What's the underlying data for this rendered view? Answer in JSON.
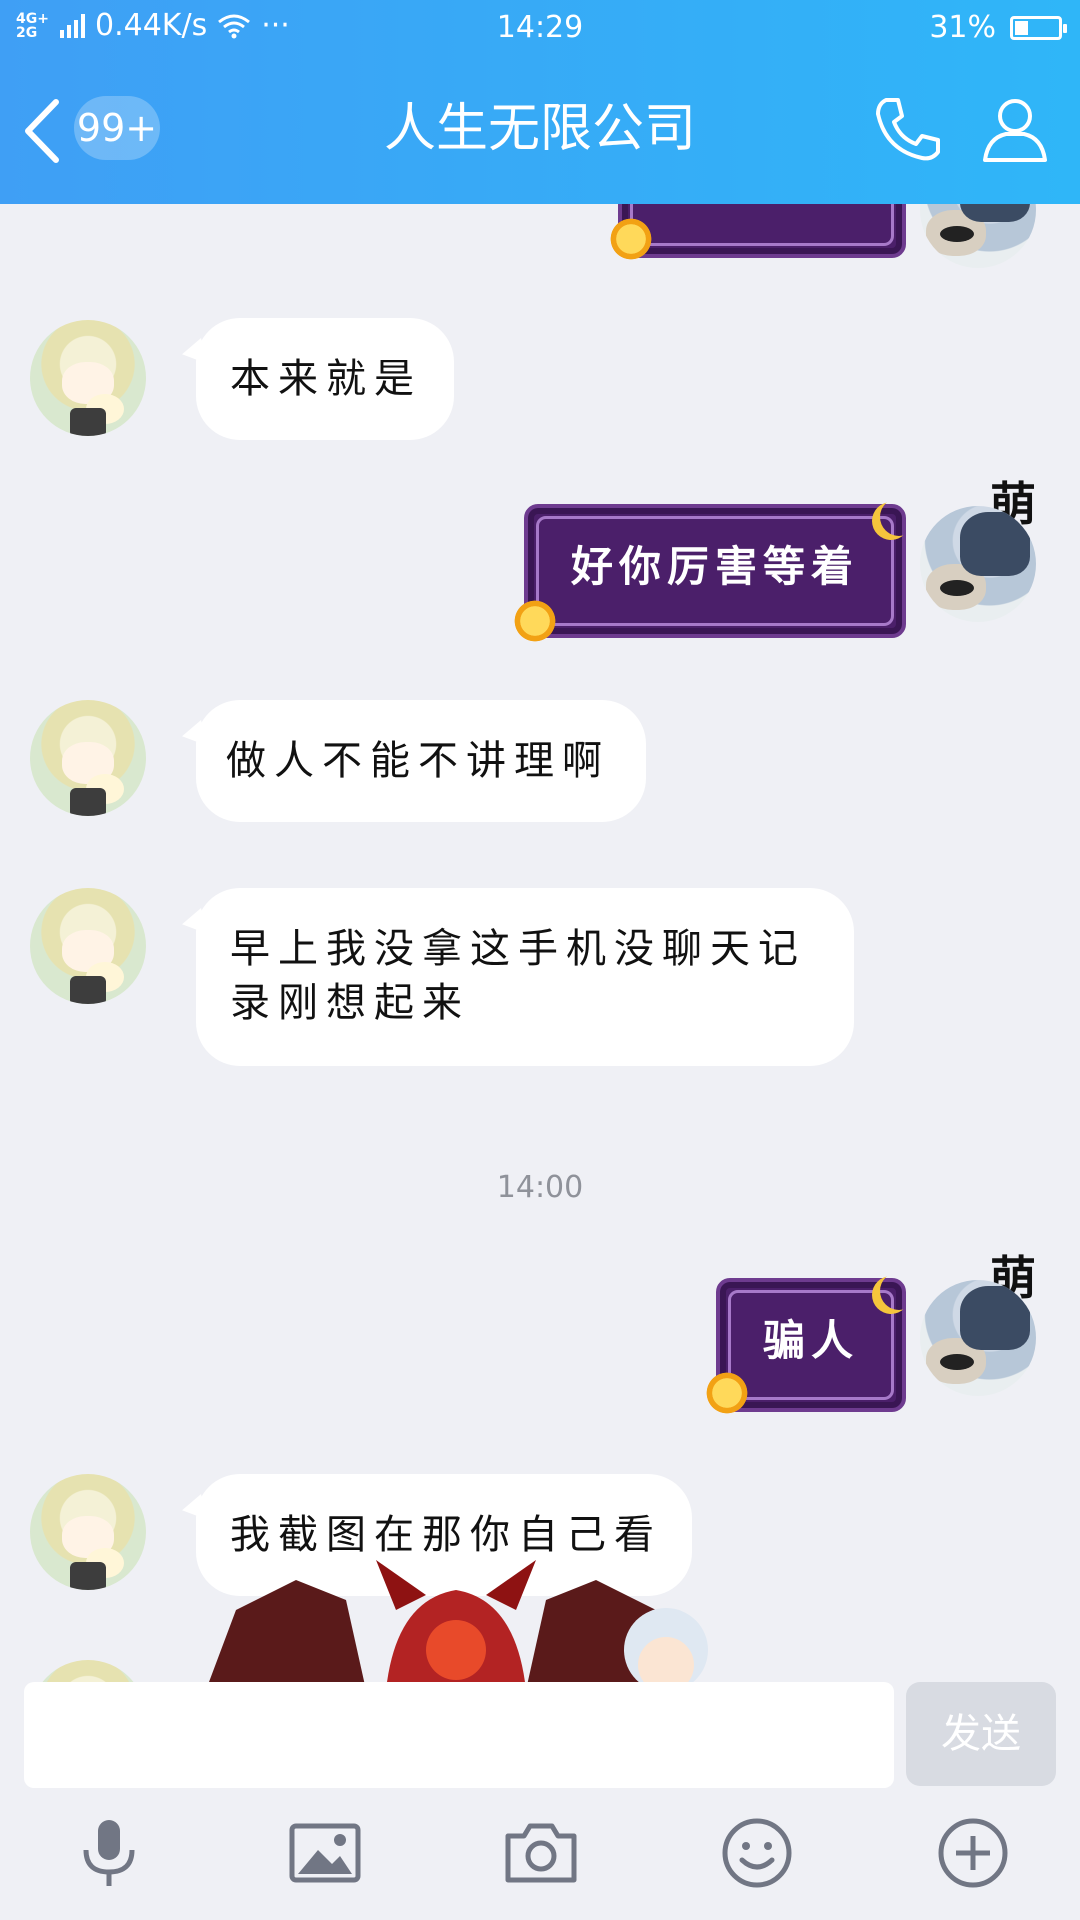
{
  "status_bar": {
    "network": "4G+ 2G",
    "speed": "0.44K/s",
    "more": "···",
    "time": "14:29",
    "battery": "31%",
    "battery_level": 0.31
  },
  "header": {
    "unread_badge": "99+",
    "title": "人生无限公司"
  },
  "messages": [
    {
      "side": "in",
      "text": "本来就是"
    },
    {
      "side": "out",
      "sender": "萌",
      "text": "好你厉害等着"
    },
    {
      "side": "in",
      "text": "做人不能不讲理啊"
    },
    {
      "side": "in",
      "text": "早上我没拿这手机没聊天记录刚想起来"
    },
    {
      "type": "time",
      "text": "14:00"
    },
    {
      "side": "out",
      "sender": "萌",
      "text": "骗人"
    },
    {
      "side": "in",
      "text": "我截图在那你自己看"
    }
  ],
  "input": {
    "value": "",
    "send_label": "发送"
  },
  "toolbar": {
    "icons": [
      "microphone-icon",
      "image-icon",
      "camera-icon",
      "emoji-icon",
      "plus-icon"
    ]
  },
  "colors": {
    "header_start": "#3f9ff5",
    "header_end": "#2fb6f8",
    "chat_bg": "#eff0f5",
    "bubble_out": "#4b1f6a",
    "send_disabled": "#d8dbe2",
    "icon_gray": "#717684"
  }
}
